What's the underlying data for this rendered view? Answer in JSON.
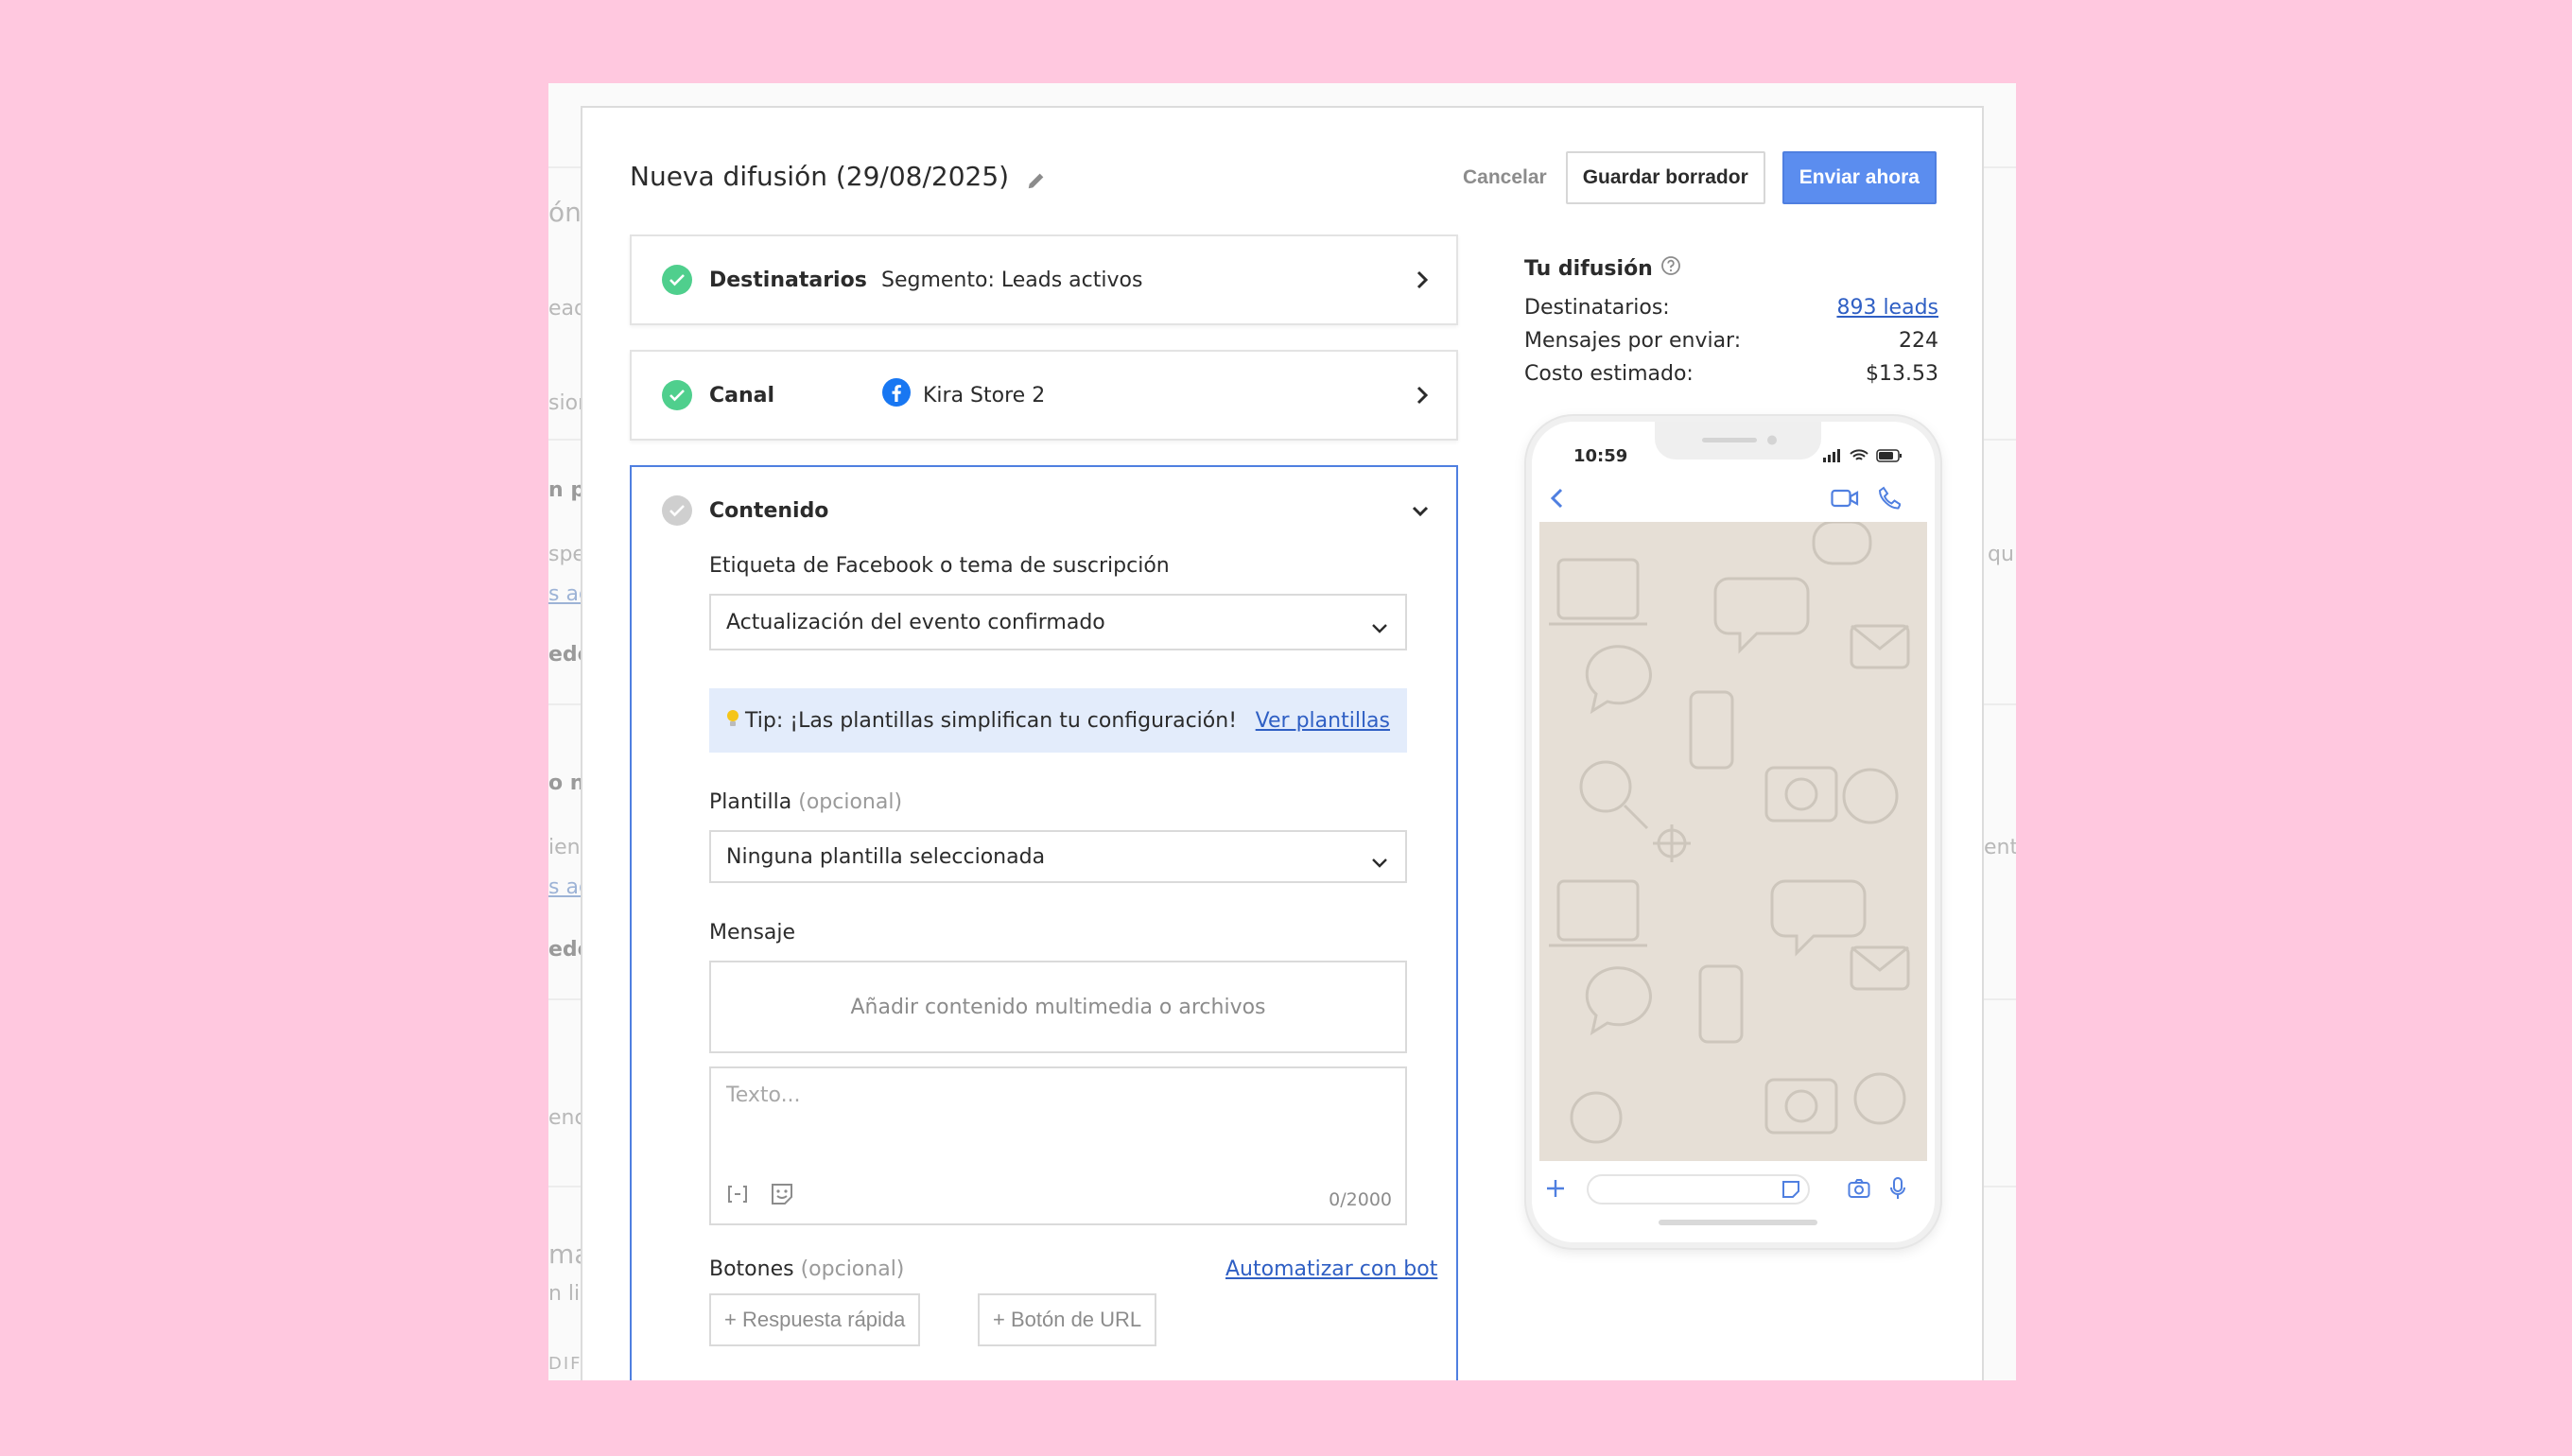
{
  "background": {
    "fragments": [
      "ón",
      "eads",
      "sion",
      "n pe",
      "spec",
      "s ac",
      "ede",
      "o nu",
      "ient",
      "s ac",
      "ede",
      "enc",
      "ma",
      "n lis",
      "DIFU",
      "qu",
      "ent"
    ]
  },
  "modal": {
    "title": "Nueva difusión (29/08/2025)",
    "actions": {
      "cancel": "Cancelar",
      "save_draft": "Guardar borrador",
      "send_now": "Enviar ahora"
    }
  },
  "steps": {
    "recipients": {
      "label": "Destinatarios",
      "value": "Segmento: Leads activos"
    },
    "channel": {
      "label": "Canal",
      "value": "Kira Store 2"
    },
    "content": {
      "label": "Contenido"
    }
  },
  "content": {
    "tag_label": "Etiqueta de Facebook o tema de suscripción",
    "tag_value": "Actualización del evento confirmado",
    "tip_text": "Tip: ¡Las plantillas simplifican tu configuración!",
    "tip_link": "Ver plantillas",
    "template_label": "Plantilla",
    "template_optional": "(opcional)",
    "template_value": "Ninguna plantilla seleccionada",
    "message_label": "Mensaje",
    "media_placeholder": "Añadir contenido multimedia o archivos",
    "text_placeholder": "Texto...",
    "char_counter": "0/2000",
    "buttons_label": "Botones",
    "buttons_optional": "(opcional)",
    "automate_link": "Automatizar con bot",
    "quick_reply": "+ Respuesta rápida",
    "url_button": "+ Botón de URL"
  },
  "summary": {
    "title": "Tu difusión",
    "recipients_label": "Destinatarios:",
    "recipients_value": "893 leads",
    "messages_label": "Mensajes por enviar:",
    "messages_value": "224",
    "cost_label": "Costo estimado:",
    "cost_value": "$13.53"
  },
  "phone": {
    "time": "10:59"
  },
  "colors": {
    "page_bg": "#ffc8df",
    "primary": "#5b8def",
    "success": "#4fcf8d",
    "link": "#2f5fc4",
    "tip_bg": "#e3ecfb",
    "chat_wallpaper": "#e6dfd6",
    "facebook": "#1877f2"
  },
  "icons": [
    "pencil-icon",
    "check-icon",
    "chevron-right-icon",
    "chevron-down-icon",
    "facebook-icon",
    "lightbulb-icon",
    "help-icon",
    "variable-icon",
    "sticker-icon",
    "back-icon",
    "video-icon",
    "phone-icon",
    "plus-icon",
    "camera-icon",
    "mic-icon"
  ]
}
